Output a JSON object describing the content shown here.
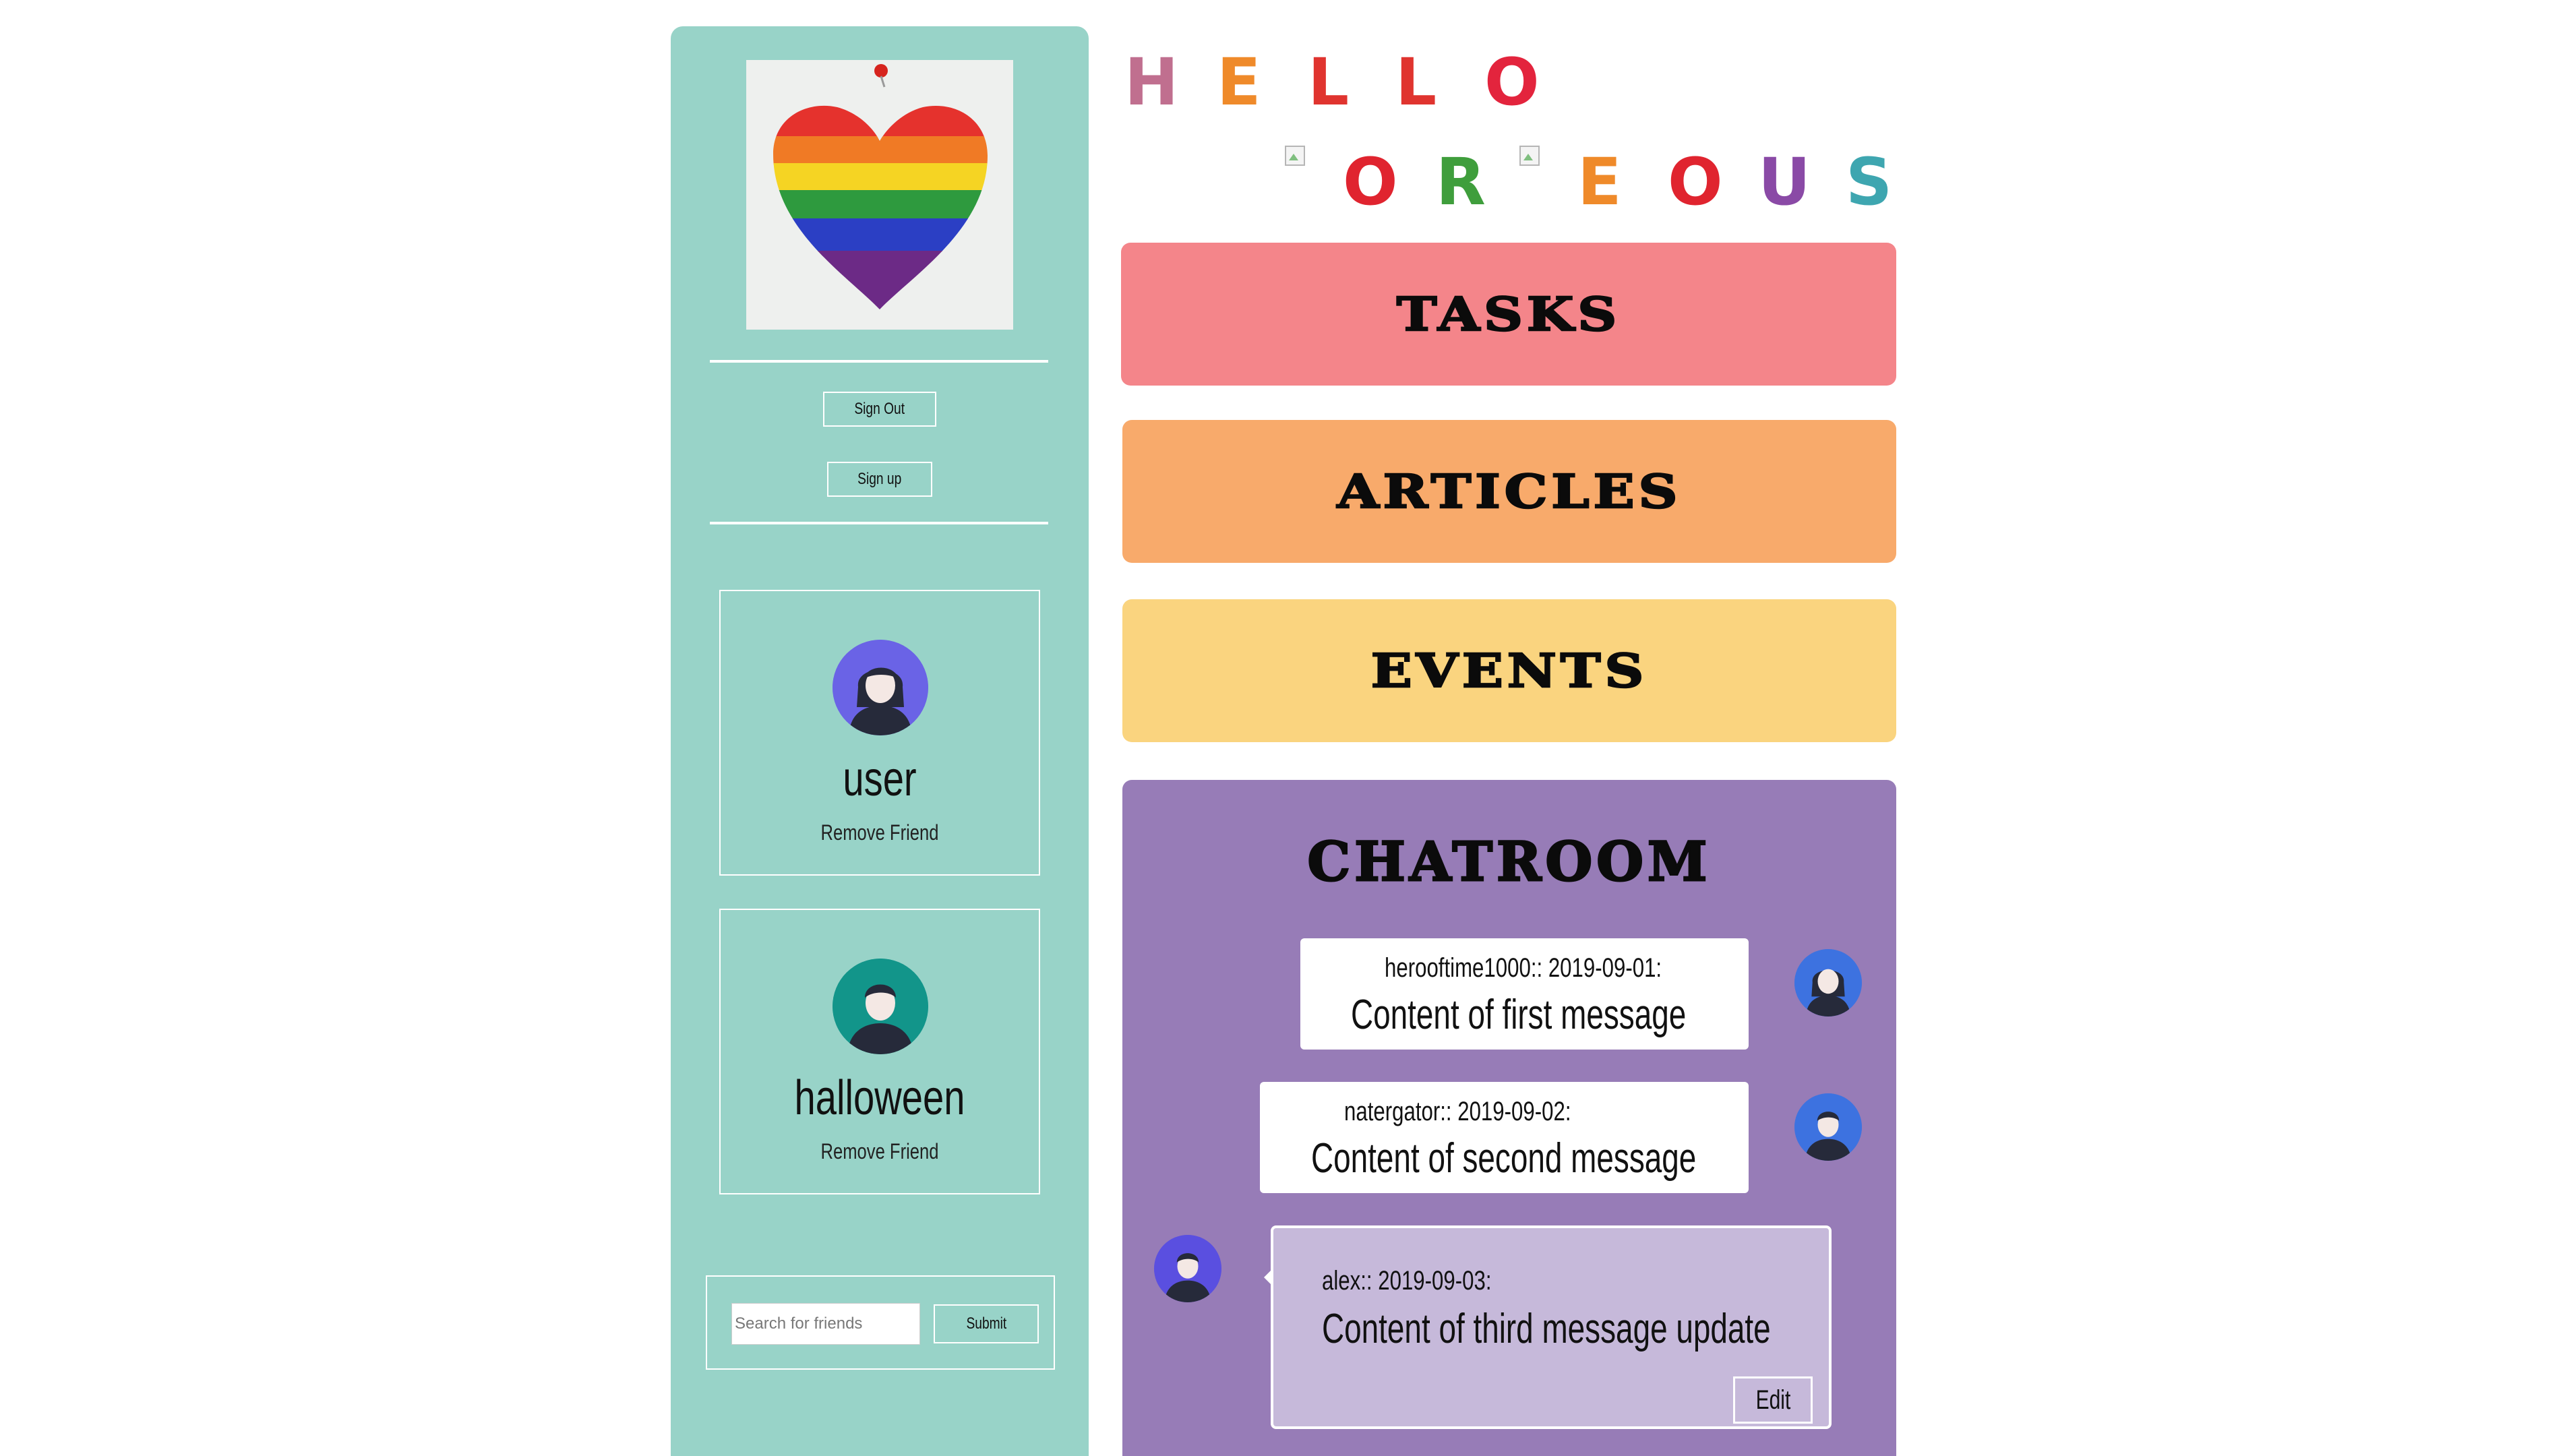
{
  "sidebar": {
    "profile_image": "rainbow-heart-painting",
    "sign_out_label": "Sign Out",
    "sign_up_label": "Sign up",
    "friends": [
      {
        "name": "user",
        "remove_label": "Remove Friend",
        "avatar": "woman-avatar-icon"
      },
      {
        "name": "halloween",
        "remove_label": "Remove Friend",
        "avatar": "man-avatar-icon"
      }
    ],
    "search": {
      "placeholder": "Search for friends",
      "submit_label": "Submit"
    }
  },
  "header": {
    "line1": [
      "H",
      "E",
      "L",
      "L",
      "O"
    ],
    "line2": [
      "O",
      "R",
      "E",
      "O",
      "U",
      "S"
    ]
  },
  "nav": {
    "tasks_label": "TASKS",
    "articles_label": "ARTICLES",
    "events_label": "EVENTS"
  },
  "chatroom": {
    "title": "CHATROOM",
    "messages": [
      {
        "author": "herooftime1000",
        "date": "2019-09-01",
        "meta": "herooftime1000:: 2019-09-01:",
        "content": "Content of first message"
      },
      {
        "author": "natergator",
        "date": "2019-09-02",
        "meta": "natergator:: 2019-09-02:",
        "content": "Content of second message"
      },
      {
        "author": "alex",
        "date": "2019-09-03",
        "meta": "alex:: 2019-09-03:",
        "content": "Content of third message update",
        "edit_label": "Edit"
      }
    ]
  },
  "colors": {
    "sidebar_bg": "#98d3c8",
    "tasks_bg": "#f4858a",
    "articles_bg": "#f8aa6b",
    "events_bg": "#fad47f",
    "chatroom_bg": "#977cb7",
    "own_message_bg": "#c6b9da"
  }
}
